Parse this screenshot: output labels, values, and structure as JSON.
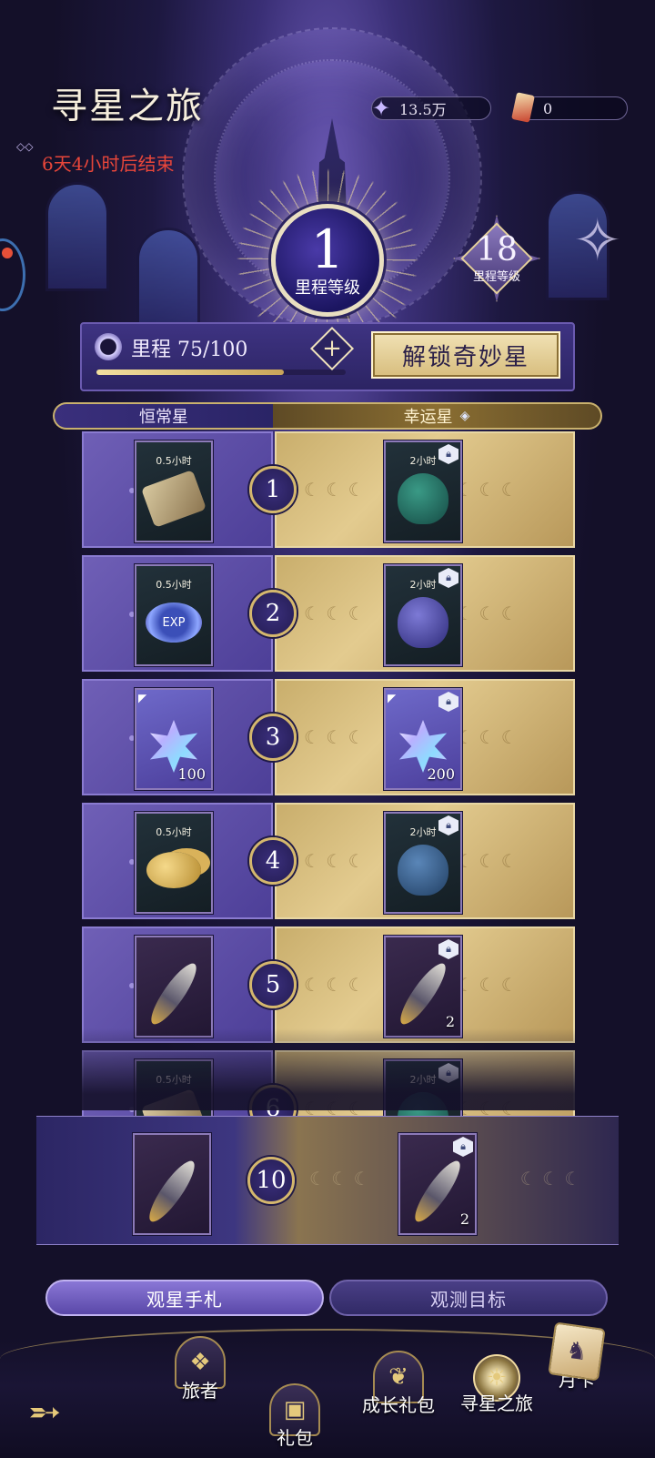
{
  "header": {
    "title": "寻星之旅",
    "countdown": "6天4小时后结束"
  },
  "resources": {
    "stars": "13.5万",
    "tickets": "0"
  },
  "level": {
    "current": "1",
    "label": "里程等级",
    "max": "18",
    "max_label": "里程等级"
  },
  "progress": {
    "text": "里程 75/100",
    "value": 75,
    "max": 100,
    "unlock_label": "解锁奇妙星"
  },
  "tracks": {
    "free": "恒常星",
    "premium": "幸运星"
  },
  "rows": [
    {
      "level": "1",
      "free": {
        "time": "0.5小时",
        "qty": "",
        "item": "scroll"
      },
      "paid": {
        "time": "2小时",
        "qty": "",
        "item": "bag-green"
      }
    },
    {
      "level": "2",
      "free": {
        "time": "0.5小时",
        "qty": "",
        "item": "exp"
      },
      "paid": {
        "time": "2小时",
        "qty": "",
        "item": "bag-purple"
      }
    },
    {
      "level": "3",
      "free": {
        "time": "",
        "qty": "100",
        "item": "star-crystal"
      },
      "paid": {
        "time": "",
        "qty": "200",
        "item": "star-crystal"
      }
    },
    {
      "level": "4",
      "free": {
        "time": "0.5小时",
        "qty": "",
        "item": "coins"
      },
      "paid": {
        "time": "2小时",
        "qty": "",
        "item": "bag-blue"
      }
    },
    {
      "level": "5",
      "free": {
        "time": "",
        "qty": "",
        "item": "feather"
      },
      "paid": {
        "time": "",
        "qty": "2",
        "item": "feather"
      }
    },
    {
      "level": "6",
      "free": {
        "time": "0.5小时",
        "qty": "",
        "item": "scroll"
      },
      "paid": {
        "time": "2小时",
        "qty": "",
        "item": "bag-green"
      }
    }
  ],
  "featured": {
    "level": "10",
    "free": {
      "qty": "",
      "item": "feather"
    },
    "paid": {
      "qty": "2",
      "item": "feather"
    }
  },
  "tabs": {
    "journal": "观星手札",
    "target": "观测目标"
  },
  "nav": {
    "traveler": "旅者",
    "gift": "礼包",
    "growth": "成长礼包",
    "journey": "寻星之旅",
    "monthly": "月卡"
  },
  "colors": {
    "countdown": "#e8463a",
    "gold": "#d4b76d",
    "free_track": "#5a4aa6",
    "premium_track": "#d6bd7e"
  }
}
